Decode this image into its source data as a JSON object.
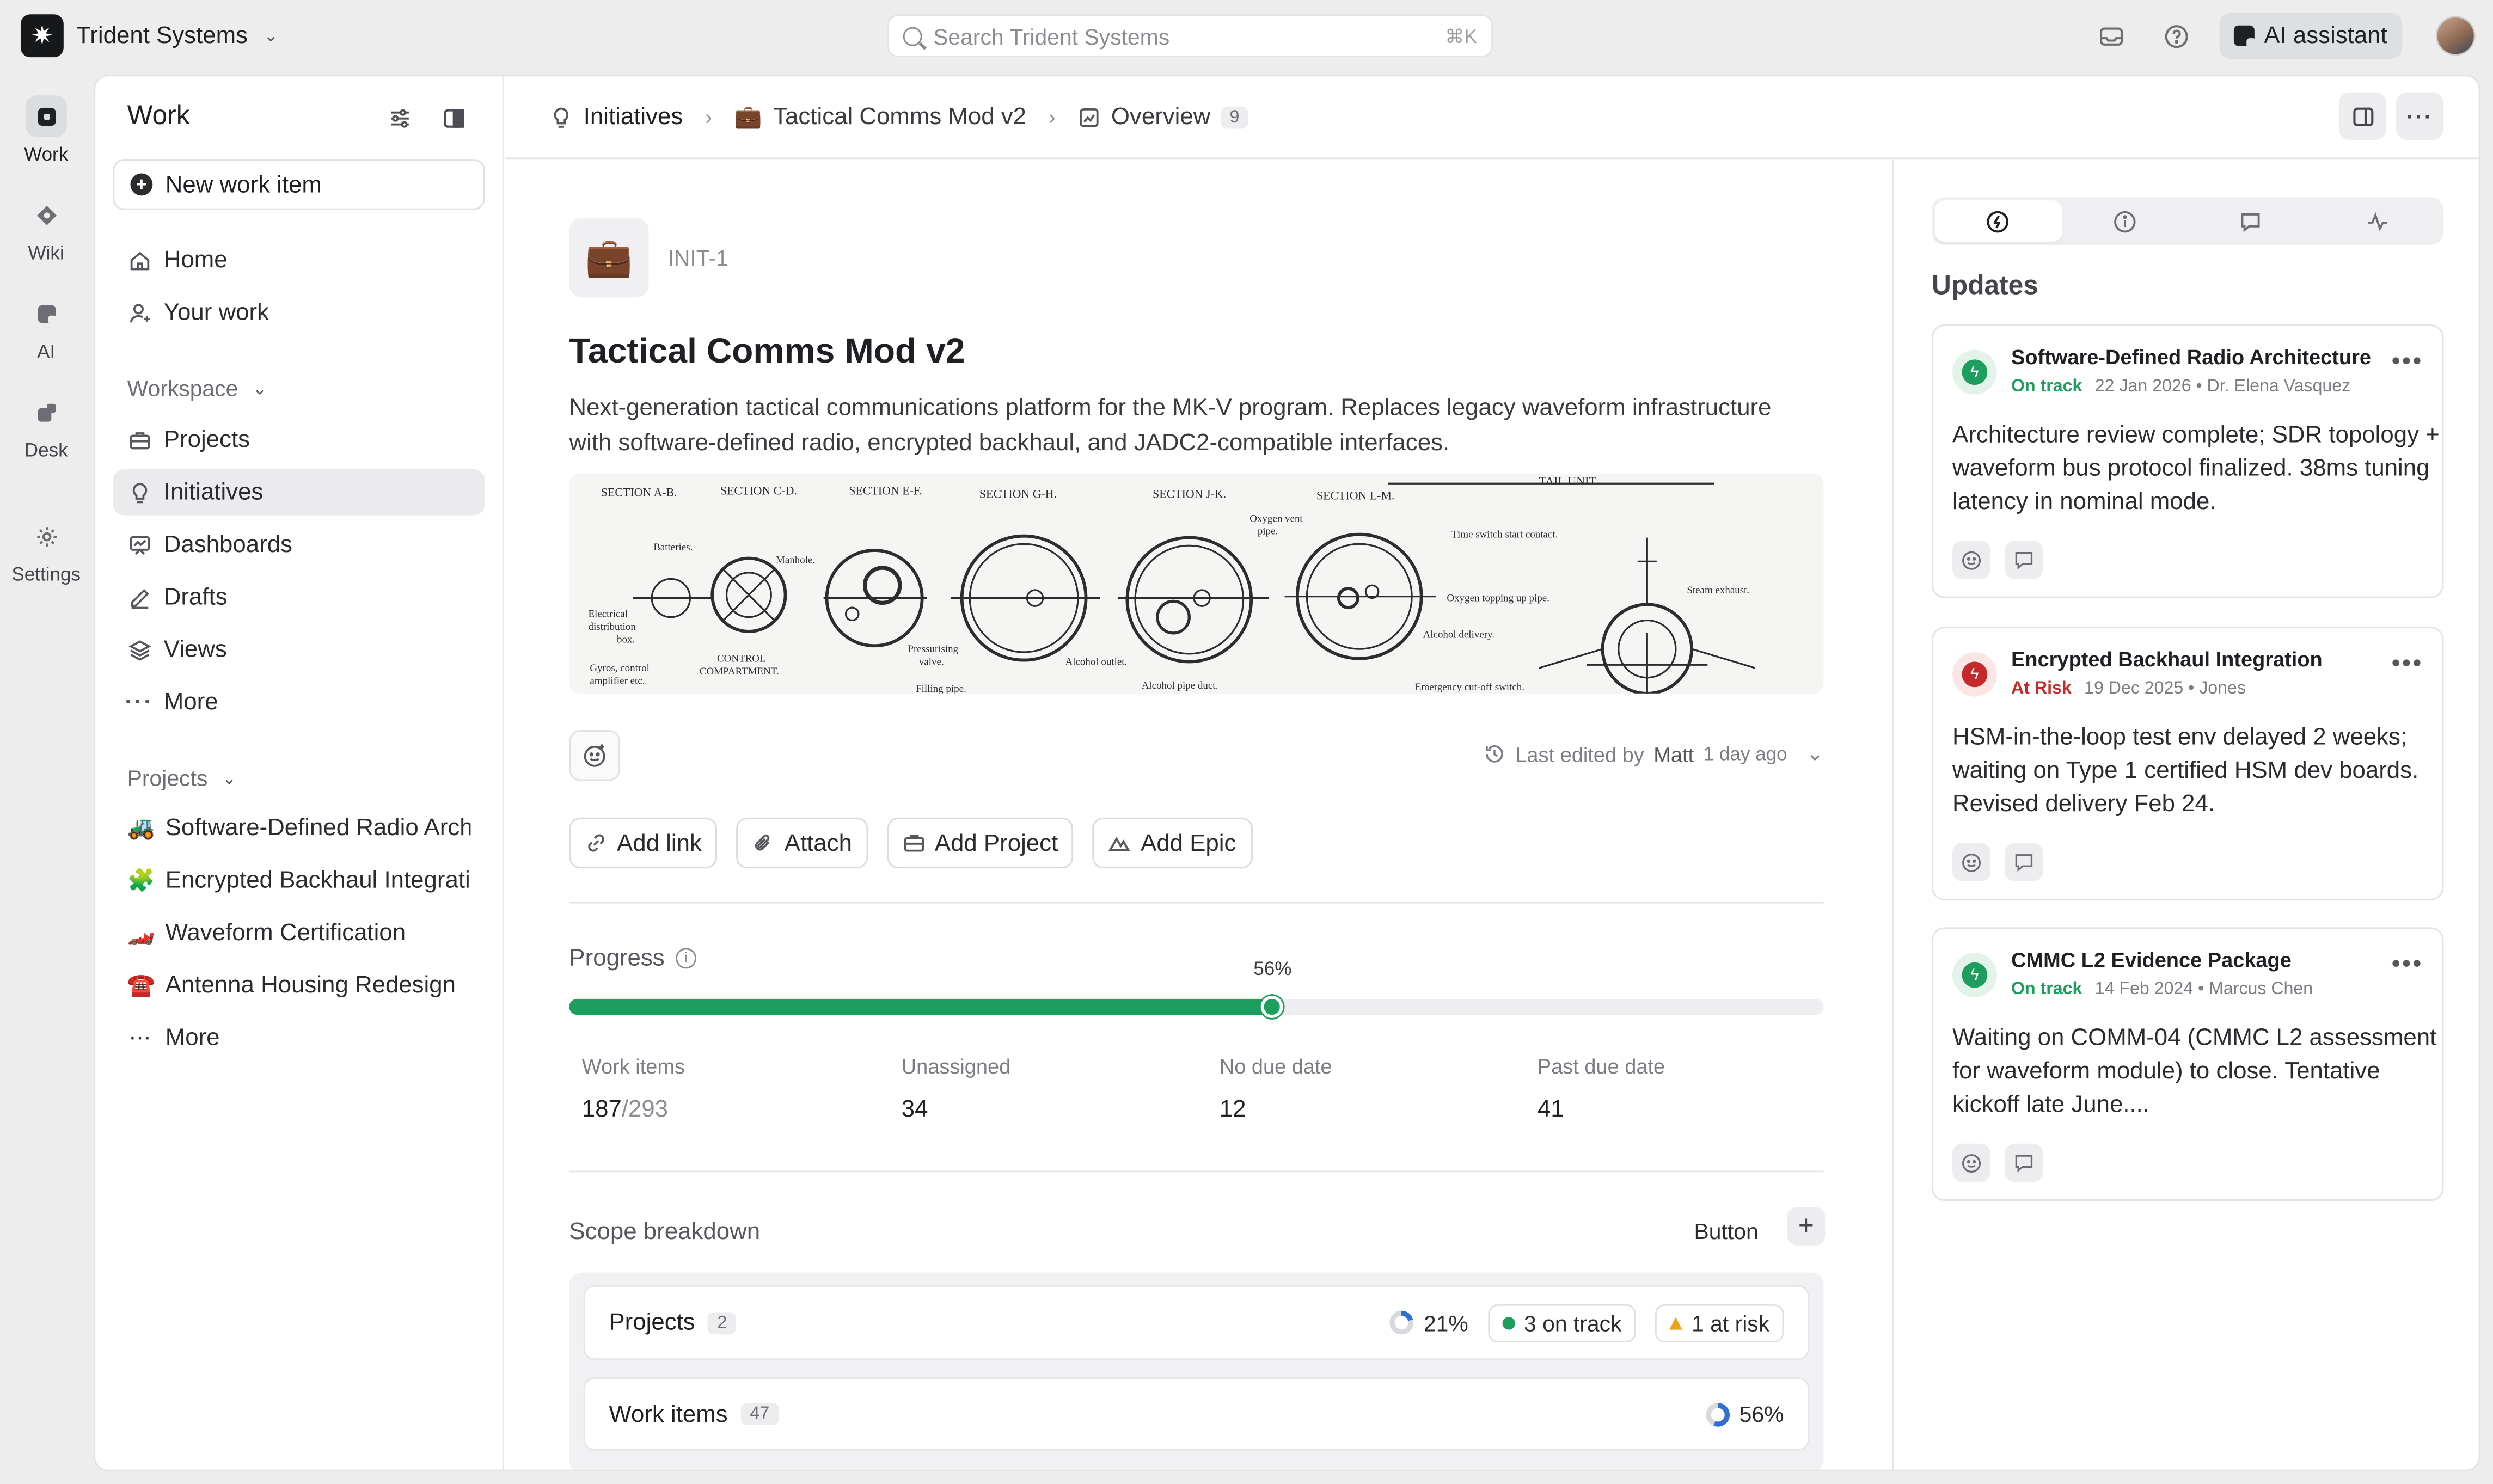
{
  "topbar": {
    "org_name": "Trident Systems",
    "search_placeholder": "Search Trident Systems",
    "search_shortcut": "⌘K",
    "ai_assistant_label": "AI assistant"
  },
  "rail": {
    "items": [
      {
        "label": "Work",
        "icon": "work-icon"
      },
      {
        "label": "Wiki",
        "icon": "wiki-icon"
      },
      {
        "label": "AI",
        "icon": "ai-icon"
      },
      {
        "label": "Desk",
        "icon": "desk-icon"
      },
      {
        "label": "Settings",
        "icon": "gear-icon"
      }
    ]
  },
  "sidebar": {
    "title": "Work",
    "new_item_label": "New work item",
    "top_nav": [
      {
        "label": "Home",
        "icon": "home-icon"
      },
      {
        "label": "Your work",
        "icon": "user-icon"
      }
    ],
    "workspace_label": "Workspace",
    "workspace_nav": [
      {
        "label": "Projects",
        "icon": "briefcase-icon"
      },
      {
        "label": "Initiatives",
        "icon": "bulb-icon",
        "active": true
      },
      {
        "label": "Dashboards",
        "icon": "dashboard-icon"
      },
      {
        "label": "Drafts",
        "icon": "pen-icon"
      },
      {
        "label": "Views",
        "icon": "layers-icon"
      },
      {
        "label": "More",
        "icon": "ellipsis-icon"
      }
    ],
    "projects_label": "Projects",
    "projects": [
      {
        "label": "Software-Defined Radio Architecture",
        "emoji": "🚜"
      },
      {
        "label": "Encrypted Backhaul Integration",
        "emoji": "🧩"
      },
      {
        "label": "Waveform Certification",
        "emoji": "🏎️"
      },
      {
        "label": "Antenna Housing Redesign",
        "emoji": "☎️"
      },
      {
        "label": "More",
        "emoji": "⋯"
      }
    ]
  },
  "breadcrumb": {
    "initiatives": "Initiatives",
    "initiative": "Tactical Comms Mod v2",
    "overview": "Overview",
    "overview_count": "9"
  },
  "initiative": {
    "emoji": "💼",
    "id": "INIT-1",
    "title": "Tactical Comms Mod v2",
    "description": "Next-generation tactical communications platform for the MK-V program. Replaces legacy waveform infrastructure with software-defined radio, encrypted backhaul, and JADC2-compatible interfaces.",
    "last_edited_prefix": "Last edited by",
    "last_edited_by": "Matt",
    "last_edited_when": "1 day ago"
  },
  "banner": {
    "section_labels": [
      "SECTION A-B.",
      "SECTION C-D.",
      "SECTION E-F.",
      "SECTION G-H.",
      "SECTION J-K.",
      "SECTION L-M."
    ],
    "tail_unit": "TAIL UNIT",
    "annotations": {
      "batteries": "Batteries.",
      "manhole": "Manhole.",
      "electrical_1": "Electrical",
      "electrical_2": "distribution",
      "electrical_3": "box.",
      "gyros_1": "Gyros, control",
      "gyros_2": "amplifier etc.",
      "control_1": "CONTROL",
      "control_2": "COMPARTMENT.",
      "pressurising_1": "Pressurising",
      "pressurising_2": "valve.",
      "filling_pipe": "Filling pipe.",
      "alcohol_outlet": "Alcohol outlet.",
      "alcohol_pipe_duct": "Alcohol pipe duct.",
      "oxygen_vent_1": "Oxygen vent",
      "oxygen_vent_2": "pipe.",
      "time_switch": "Time switch start contact.",
      "oxygen_topping": "Oxygen topping up pipe.",
      "alcohol_delivery": "Alcohol delivery.",
      "steam_exhaust": "Steam exhaust.",
      "emergency": "Emergency cut-off switch."
    }
  },
  "actions": [
    {
      "label": "Add link",
      "icon": "link-icon"
    },
    {
      "label": "Attach",
      "icon": "paperclip-icon"
    },
    {
      "label": "Add Project",
      "icon": "briefcase-icon"
    },
    {
      "label": "Add Epic",
      "icon": "mountain-icon"
    }
  ],
  "progress": {
    "label": "Progress",
    "percent": 56,
    "percent_label": "56%",
    "stats": [
      {
        "label": "Work items",
        "value": "187",
        "denominator": "/293"
      },
      {
        "label": "Unassigned",
        "value": "34",
        "denominator": ""
      },
      {
        "label": "No due date",
        "value": "12",
        "denominator": ""
      },
      {
        "label": "Past due date",
        "value": "41",
        "denominator": ""
      }
    ]
  },
  "scope": {
    "title": "Scope breakdown",
    "button_label": "Button",
    "rows": [
      {
        "name": "Projects",
        "count": "2",
        "percent": 21,
        "percent_label": "21%",
        "on_track": "3 on track",
        "at_risk": "1 at risk"
      },
      {
        "name": "Work items",
        "count": "47",
        "percent": 56,
        "percent_label": "56%"
      }
    ]
  },
  "updates": {
    "title": "Updates",
    "tabs": [
      "updates-tab-icon",
      "info-icon",
      "comment-icon",
      "activity-icon"
    ],
    "cards": [
      {
        "title": "Software-Defined Radio Architecture",
        "status": "On track",
        "status_kind": "on",
        "date": "22 Jan 2026",
        "author": "• Dr. Elena Vasquez",
        "body": "Architecture review complete; SDR topology + waveform bus protocol finalized. 38ms tuning latency in nominal mode."
      },
      {
        "title": "Encrypted Backhaul Integration",
        "status": "At Risk",
        "status_kind": "risk",
        "date": "19 Dec 2025",
        "author": "• Jones",
        "body": "HSM-in-the-loop test env delayed 2 weeks; waiting on Type 1 certified HSM dev boards. Revised delivery Feb 24."
      },
      {
        "title": "CMMC L2 Evidence Package",
        "status": "On track",
        "status_kind": "on",
        "date": "14 Feb 2024",
        "author": "• Marcus Chen",
        "body": "Waiting on COMM-04 (CMMC L2 assessment for waveform module) to close. Tentative kickoff late June...."
      }
    ]
  },
  "colors": {
    "accent_green": "#1e9e5e",
    "risk_red": "#c52a2a",
    "warning_amber": "#e8a317",
    "ring_blue": "#2f6fd1"
  }
}
